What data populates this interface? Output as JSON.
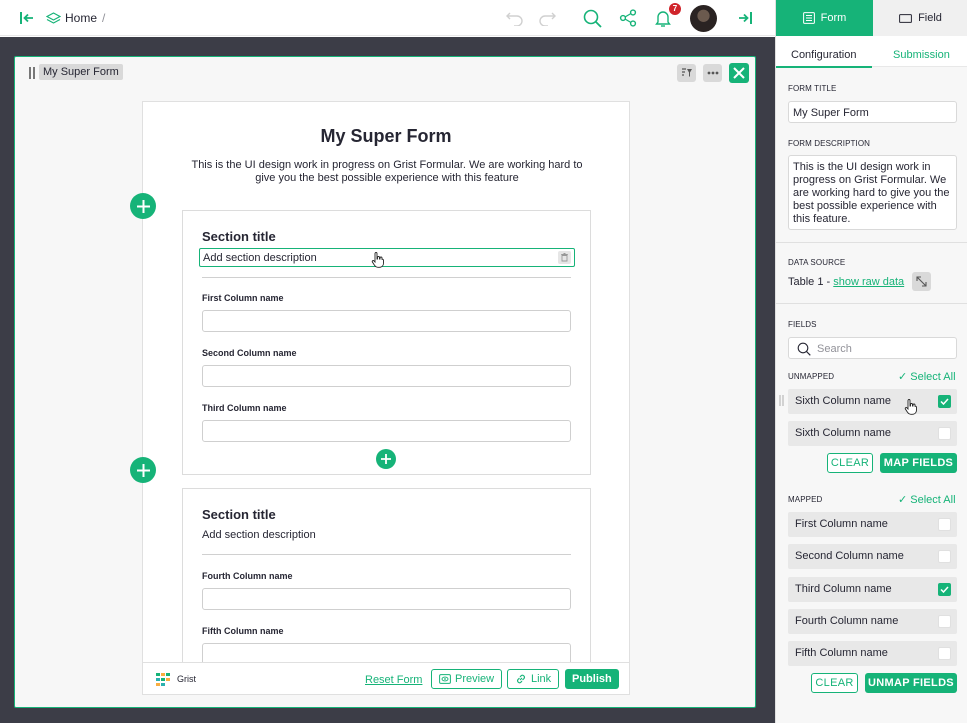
{
  "colors": {
    "accent": "#16b378",
    "canvas": "#3c3d47",
    "badge": "#d0242b"
  },
  "topbar": {
    "breadcrumb_home": "Home",
    "breadcrumb_sep": "/",
    "notification_count": "7"
  },
  "widget": {
    "title": "My Super Form"
  },
  "form": {
    "title": "My Super Form",
    "description": "This is the UI design work in progress on Grist Formular. We are working hard to give you the best possible experience with this feature",
    "sections": [
      {
        "title": "Section title",
        "description": "Add section description",
        "fields": [
          "First Column name",
          "Second Column name",
          "Third Column name"
        ]
      },
      {
        "title": "Section title",
        "description": "Add section description",
        "fields": [
          "Fourth Column name",
          "Fifth Column name"
        ]
      }
    ],
    "footer": {
      "brand": "Grist",
      "reset_label": "Reset Form",
      "preview_label": "Preview",
      "link_label": "Link",
      "publish_label": "Publish"
    }
  },
  "right_panel": {
    "tabs": {
      "form": "Form",
      "field": "Field"
    },
    "subtabs": {
      "configuration": "Configuration",
      "submission": "Submission"
    },
    "form_title_label": "FORM TITLE",
    "form_title_value": "My Super Form",
    "form_description_label": "FORM DESCRIPTION",
    "form_description_value": "This is the UI design work in progress on Grist Formular. We are working hard to give you the best possible experience with this feature.",
    "data_source_label": "DATA SOURCE",
    "data_source_table": "Table 1 - ",
    "data_source_link": "show raw data",
    "fields_label": "FIELDS",
    "search_placeholder": "Search",
    "unmapped_label": "UNMAPPED",
    "select_all": "Select All",
    "unmapped": [
      {
        "name": "Sixth Column name",
        "checked": true
      },
      {
        "name": "Sixth Column name",
        "checked": false
      }
    ],
    "clear_label": "CLEAR",
    "map_fields_label": "MAP FIELDS",
    "mapped_label": "MAPPED",
    "mapped": [
      {
        "name": "First Column name",
        "checked": false
      },
      {
        "name": "Second Column name",
        "checked": false
      },
      {
        "name": "Third Column name",
        "checked": true
      },
      {
        "name": "Fourth Column name",
        "checked": false
      },
      {
        "name": "Fifth Column name",
        "checked": false
      }
    ],
    "unmap_fields_label": "UNMAP FIELDS"
  }
}
